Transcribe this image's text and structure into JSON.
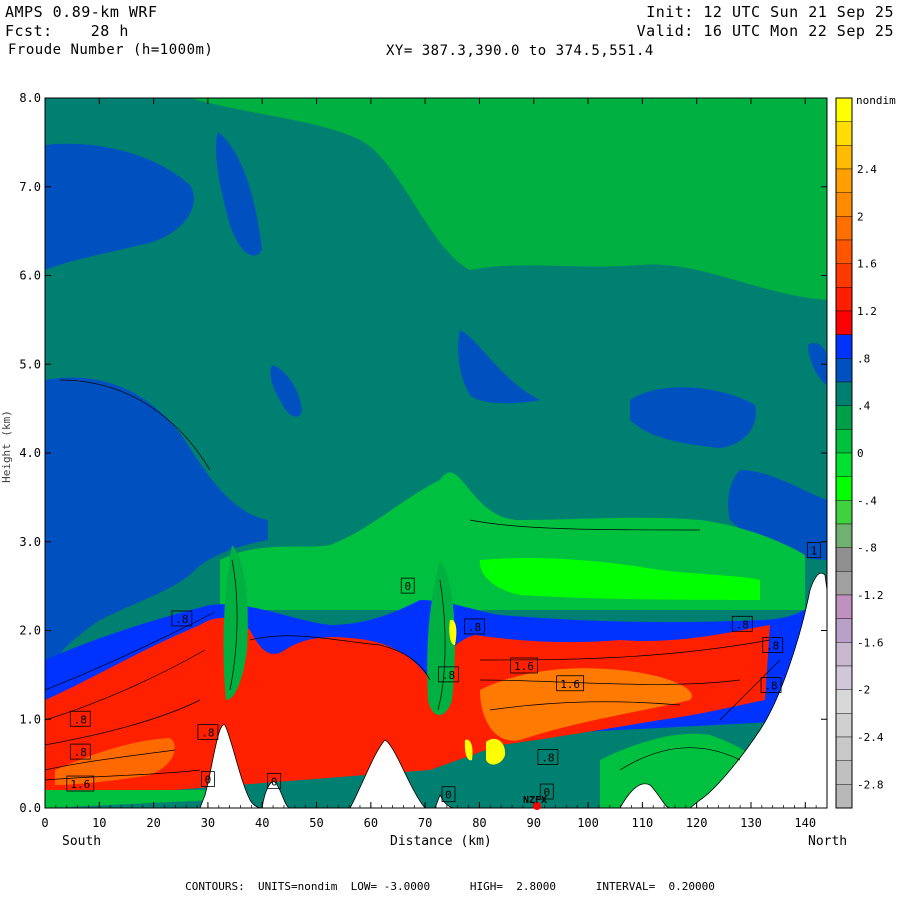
{
  "header": {
    "model": "AMPS 0.89-km WRF",
    "forecast": "Fcst:    28 h",
    "field": "Froude Number (h=1000m)",
    "init": "Init: 12 UTC Sun 21 Sep 25",
    "valid": "Valid: 16 UTC Mon 22 Sep 25",
    "xy": "XY= 387.3,390.0 to 374.5,551.4"
  },
  "axes": {
    "x_left_label": "South",
    "x_center_label": "Distance (km)",
    "x_right_label": "North",
    "y_label": "Height (km)"
  },
  "footer": {
    "contours": "CONTOURS:  UNITS=nondim  LOW= -3.0000      HIGH=  2.8000      INTERVAL=  0.20000"
  },
  "station_label": "NZFX",
  "chart_data": {
    "type": "heatmap",
    "title": "Froude Number (h=1000m)",
    "xlabel": "Distance (km)",
    "ylabel": "Height (km)",
    "xlim": [
      0,
      144
    ],
    "ylim": [
      0,
      8
    ],
    "x_ticks": [
      0,
      10,
      20,
      30,
      40,
      50,
      60,
      70,
      80,
      90,
      100,
      110,
      120,
      130,
      140
    ],
    "y_ticks": [
      "0.0",
      "1.0",
      "2.0",
      "3.0",
      "4.0",
      "5.0",
      "6.0",
      "7.0",
      "8.0"
    ],
    "y_tick_values": [
      0,
      1,
      2,
      3,
      4,
      5,
      6,
      7,
      8
    ],
    "colorbar": {
      "unit": "nondim",
      "levels": [
        3.0,
        2.8,
        2.6,
        2.4,
        2.2,
        2.0,
        1.8,
        1.6,
        1.4,
        1.2,
        1.0,
        0.8,
        0.6,
        0.4,
        0.2,
        0.0,
        -0.2,
        -0.4,
        -0.6,
        -0.8,
        -1.0,
        -1.2,
        -1.4,
        -1.6,
        -1.8,
        -2.0,
        -2.2,
        -2.4,
        -2.6,
        -2.8,
        -3.0
      ],
      "labels": [
        "2.4",
        "2",
        "1.6",
        "1.2",
        ".8",
        ".4",
        "0",
        "-.4",
        "-.8",
        "-1.2",
        "-1.6",
        "-2",
        "-2.4",
        "-2.8"
      ],
      "label_values": [
        2.4,
        2.0,
        1.6,
        1.2,
        0.8,
        0.4,
        0.0,
        -0.4,
        -0.8,
        -1.2,
        -1.6,
        -2.0,
        -2.4,
        -2.8
      ],
      "colors": [
        "#ffff00",
        "#ffdd00",
        "#ffbb00",
        "#ffa000",
        "#ff8c00",
        "#ff7000",
        "#ff5500",
        "#ff3a00",
        "#ff1e00",
        "#ff0000",
        "#0033ff",
        "#0050c0",
        "#008070",
        "#00a048",
        "#00c040",
        "#00e030",
        "#00ff00",
        "#40d040",
        "#70b070",
        "#909090",
        "#a0a0a0",
        "#c090c0",
        "#b8a0c8",
        "#c8b8d0",
        "#d0c8d8",
        "#d8d8d8",
        "#d0d0d0",
        "#c8c8c8",
        "#c0c0c0",
        "#b8b8b8"
      ]
    },
    "contour_labels": [
      {
        "text": ".8",
        "x": 6.5,
        "y": 1.0
      },
      {
        "text": ".8",
        "x": 6.5,
        "y": 0.63
      },
      {
        "text": "1.6",
        "x": 6.5,
        "y": 0.27
      },
      {
        "text": ".8",
        "x": 25.2,
        "y": 2.13
      },
      {
        "text": ".8",
        "x": 30.0,
        "y": 0.85
      },
      {
        "text": "0",
        "x": 30.0,
        "y": 0.32
      },
      {
        "text": "0",
        "x": 42.2,
        "y": 0.3
      },
      {
        "text": "0",
        "x": 66.8,
        "y": 2.5
      },
      {
        "text": ".8",
        "x": 74.3,
        "y": 1.5
      },
      {
        "text": ".8",
        "x": 79.1,
        "y": 2.04
      },
      {
        "text": "1.6",
        "x": 88.2,
        "y": 1.6
      },
      {
        "text": "1.6",
        "x": 96.7,
        "y": 1.4
      },
      {
        "text": ".8",
        "x": 92.6,
        "y": 0.57
      },
      {
        "text": "0",
        "x": 74.3,
        "y": 0.15
      },
      {
        "text": "0",
        "x": 92.4,
        "y": 0.18
      },
      {
        "text": ".8",
        "x": 128.4,
        "y": 2.07
      },
      {
        "text": ".8",
        "x": 134.0,
        "y": 1.83
      },
      {
        "text": ".8",
        "x": 133.7,
        "y": 1.38
      },
      {
        "text": "1",
        "x": 141.6,
        "y": 2.9
      }
    ],
    "station": {
      "name": "NZFX",
      "x": 90.5
    }
  }
}
